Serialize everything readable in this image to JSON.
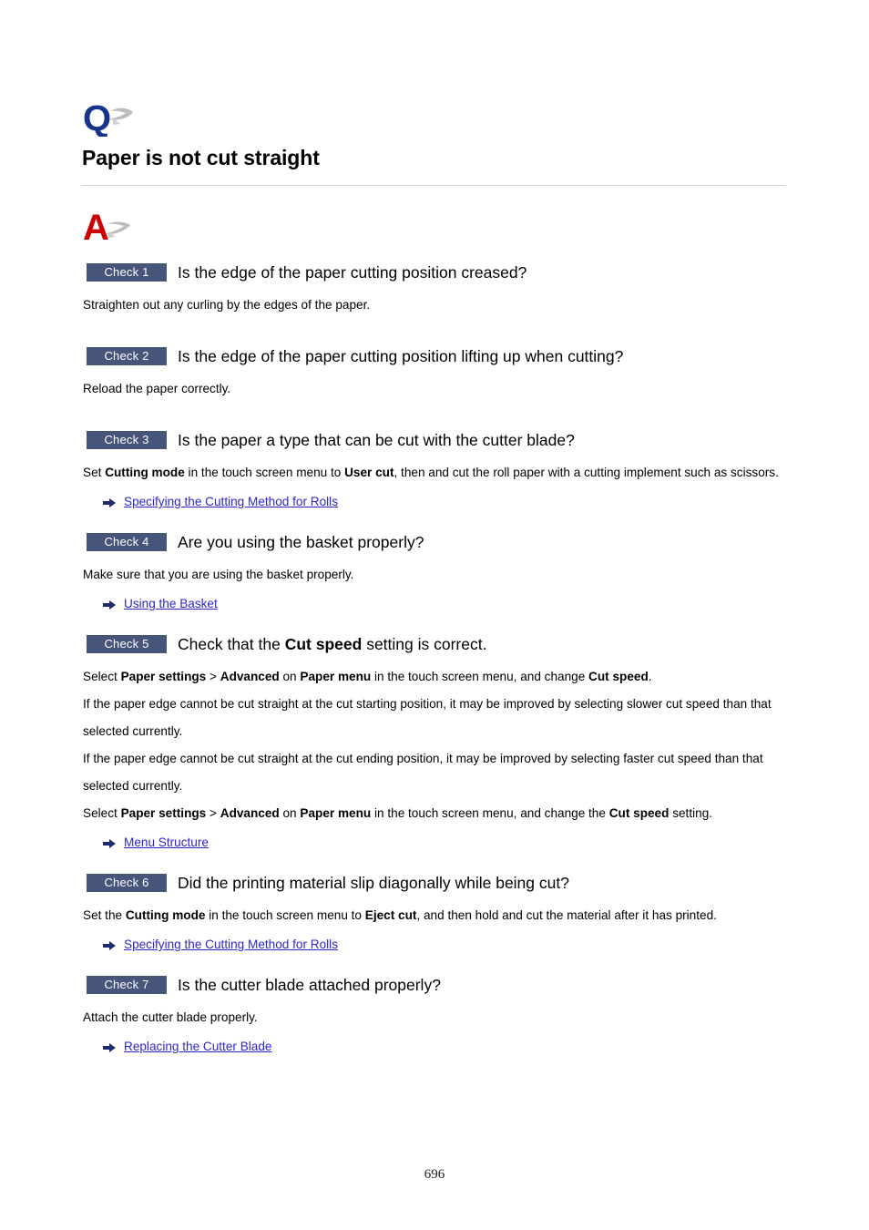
{
  "document": {
    "question_icon": "q-letter-icon",
    "answer_icon": "a-letter-icon",
    "title": "Paper is not cut straight",
    "page_number": "696",
    "colors": {
      "badge_background": "#47557a",
      "badge_text": "#ffffff",
      "link": "#2a26c8",
      "arrow": "#1b2a6b",
      "q_icon": "#16348c",
      "a_icon": "#cc0000",
      "swoosh": "#b8b8b8",
      "rule": "#cfcfcf"
    }
  },
  "checks": [
    {
      "badge": "Check 1",
      "title_prefix": "Is the edge of the paper cutting position creased?",
      "paragraphs": [
        {
          "parts": [
            {
              "text": "Straighten out any curling by the edges of the paper.",
              "bold": false
            }
          ]
        }
      ],
      "links": []
    },
    {
      "badge": "Check 2",
      "title_prefix": "Is the edge of the paper cutting position lifting up when cutting?",
      "paragraphs": [
        {
          "parts": [
            {
              "text": "Reload the paper correctly.",
              "bold": false
            }
          ]
        }
      ],
      "links": []
    },
    {
      "badge": "Check 3",
      "title_prefix": "Is the paper a type that can be cut with the cutter blade?",
      "paragraphs": [
        {
          "parts": [
            {
              "text": "Set ",
              "bold": false
            },
            {
              "text": "Cutting mode",
              "bold": true
            },
            {
              "text": " in the touch screen menu to ",
              "bold": false
            },
            {
              "text": "User cut",
              "bold": true
            },
            {
              "text": ", then and cut the roll paper with a cutting implement such as scissors.",
              "bold": false
            }
          ]
        }
      ],
      "links": [
        {
          "label": "Specifying the Cutting Method for Rolls"
        }
      ]
    },
    {
      "badge": "Check 4",
      "title_prefix": "Are you using the basket properly?",
      "paragraphs": [
        {
          "parts": [
            {
              "text": "Make sure that you are using the basket properly.",
              "bold": false
            }
          ]
        }
      ],
      "links": [
        {
          "label": "Using the Basket"
        }
      ]
    },
    {
      "badge": "Check 5",
      "title_parts": [
        {
          "text": "Check that the ",
          "bold": false
        },
        {
          "text": "Cut speed",
          "bold": true
        },
        {
          "text": " setting is correct.",
          "bold": false
        }
      ],
      "paragraphs": [
        {
          "parts": [
            {
              "text": "Select ",
              "bold": false
            },
            {
              "text": "Paper settings",
              "bold": true
            },
            {
              "text": " > ",
              "bold": false
            },
            {
              "text": "Advanced",
              "bold": true
            },
            {
              "text": " on ",
              "bold": false
            },
            {
              "text": "Paper menu",
              "bold": true
            },
            {
              "text": " in the touch screen menu, and change ",
              "bold": false
            },
            {
              "text": "Cut speed",
              "bold": true
            },
            {
              "text": ".",
              "bold": false
            }
          ]
        },
        {
          "parts": [
            {
              "text": "If the paper edge cannot be cut straight at the cut starting position, it may be improved by selecting slower cut speed than that selected currently.",
              "bold": false
            }
          ]
        },
        {
          "parts": [
            {
              "text": "If the paper edge cannot be cut straight at the cut ending position, it may be improved by selecting faster cut speed than that selected currently.",
              "bold": false
            }
          ]
        },
        {
          "parts": [
            {
              "text": "Select ",
              "bold": false
            },
            {
              "text": "Paper settings",
              "bold": true
            },
            {
              "text": " > ",
              "bold": false
            },
            {
              "text": "Advanced",
              "bold": true
            },
            {
              "text": " on ",
              "bold": false
            },
            {
              "text": "Paper menu",
              "bold": true
            },
            {
              "text": " in the touch screen menu, and change the ",
              "bold": false
            },
            {
              "text": "Cut speed",
              "bold": true
            },
            {
              "text": " setting.",
              "bold": false
            }
          ]
        }
      ],
      "links": [
        {
          "label": "Menu Structure"
        }
      ]
    },
    {
      "badge": "Check 6",
      "title_prefix": "Did the printing material slip diagonally while being cut?",
      "paragraphs": [
        {
          "parts": [
            {
              "text": "Set the ",
              "bold": false
            },
            {
              "text": "Cutting mode",
              "bold": true
            },
            {
              "text": " in the touch screen menu to ",
              "bold": false
            },
            {
              "text": "Eject cut",
              "bold": true
            },
            {
              "text": ", and then hold and cut the material after it has printed.",
              "bold": false
            }
          ]
        }
      ],
      "links": [
        {
          "label": "Specifying the Cutting Method for Rolls"
        }
      ]
    },
    {
      "badge": "Check 7",
      "title_prefix": "Is the cutter blade attached properly?",
      "paragraphs": [
        {
          "parts": [
            {
              "text": "Attach the cutter blade properly.",
              "bold": false
            }
          ]
        }
      ],
      "links": [
        {
          "label": "Replacing the Cutter Blade"
        }
      ]
    }
  ]
}
